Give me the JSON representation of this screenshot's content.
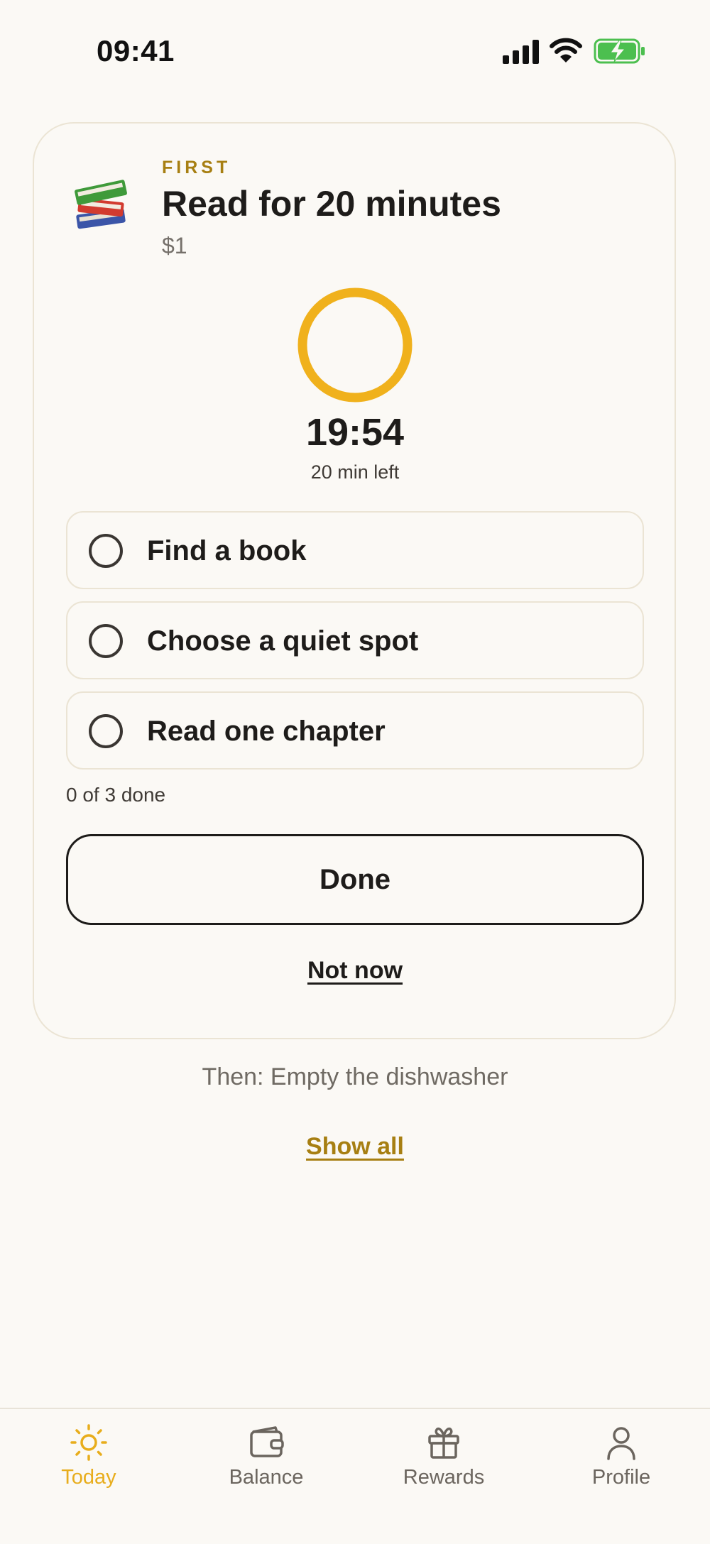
{
  "status_bar": {
    "time": "09:41"
  },
  "task": {
    "eyebrow": "FIRST",
    "title": "Read for 20 minutes",
    "reward": "$1",
    "emoji": "books-icon"
  },
  "timer": {
    "time": "19:54",
    "left_label": "20 min left",
    "progress": 0.0
  },
  "steps": [
    {
      "label": "Find a book",
      "checked": false
    },
    {
      "label": "Choose a quiet spot",
      "checked": false
    },
    {
      "label": "Read one chapter",
      "checked": false
    }
  ],
  "progress_text": "0 of 3 done",
  "actions": {
    "done_label": "Done",
    "not_now_label": "Not now"
  },
  "next": {
    "text": "Then: Empty the dishwasher",
    "show_all_label": "Show all"
  },
  "tabs": [
    {
      "label": "Today",
      "icon": "sun-icon",
      "active": true
    },
    {
      "label": "Balance",
      "icon": "wallet-icon",
      "active": false
    },
    {
      "label": "Rewards",
      "icon": "gift-icon",
      "active": false
    },
    {
      "label": "Profile",
      "icon": "person-icon",
      "active": false
    }
  ],
  "colors": {
    "accent": "#e8ad1c",
    "eyebrow": "#a77f12",
    "background": "#fbf9f5",
    "border": "#ebe4d4",
    "battery": "#4cbf4f"
  }
}
